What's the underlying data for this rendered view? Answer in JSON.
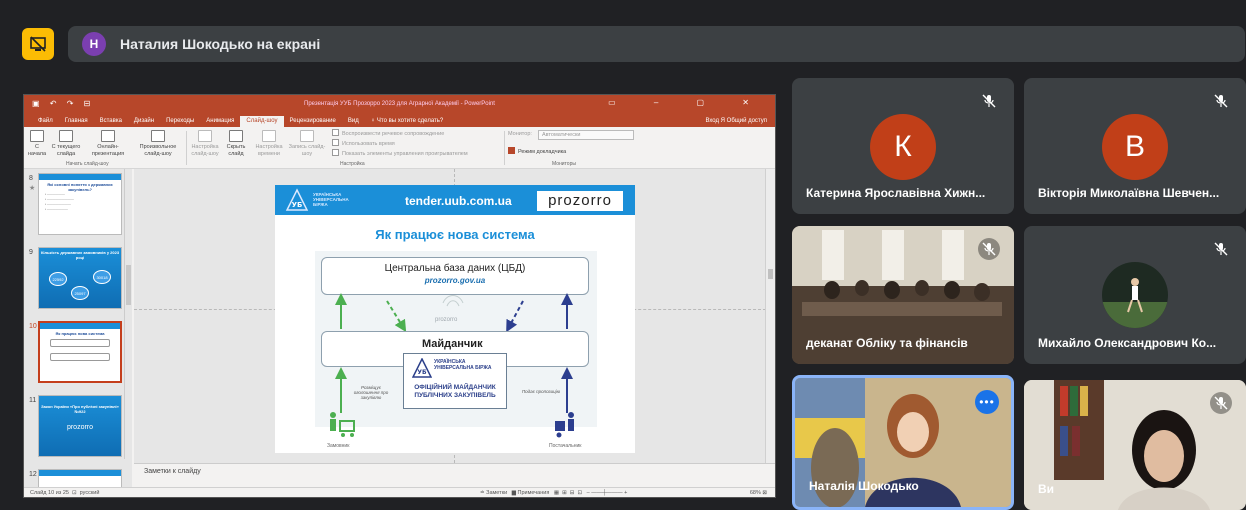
{
  "presenting": {
    "avatar_letter": "Н",
    "banner_text": "Наталия Шокодько на екрані"
  },
  "ppt": {
    "window_title": "Презентація УУБ Прозорро 2023 для Аграрної Академії - PowerPoint",
    "tabs": [
      "Файл",
      "Главная",
      "Вставка",
      "Дизайн",
      "Переходы",
      "Анимация",
      "Слайд-шоу",
      "Рецензирование",
      "Вид",
      "♀ Что вы хотите сделать?"
    ],
    "active_tab": "Слайд-шоу",
    "account": "Вход   Я Общий доступ",
    "ribbon": {
      "btn_from_start": "С начала",
      "btn_from_current": "С текущего слайда",
      "btn_online": "Онлайн-презентация",
      "btn_custom": "Произвольное слайд-шоу",
      "group_start": "Начать слайд-шоу",
      "btn_setup": "Настройка слайд-шоу",
      "btn_hide": "Скрыть слайд",
      "btn_timing": "Настройка времени",
      "btn_record": "Запись слайд-шоу",
      "chk_narration": "Воспроизвести речевое сопровождение",
      "chk_timings": "Использовать время",
      "chk_controls": "Показать элементы управления проигрывателем",
      "group_setup": "Настройка",
      "monitor_label": "Монитор:",
      "monitor_value": "Автоматически",
      "chk_presenter": "Режим докладчика",
      "group_monitors": "Мониторы"
    },
    "thumbnails": [
      {
        "num": "8",
        "title": "Які основні поняття з державних закупівель?"
      },
      {
        "num": "9",
        "title": "Кількість державних замовників у 2023 році",
        "values": [
          "22592",
          "30018",
          "25097"
        ]
      },
      {
        "num": "10",
        "title": "Як працює нова система"
      },
      {
        "num": "11",
        "title": "Закон України «Про публічні закупівлі» №922",
        "brand": "prozorro"
      },
      {
        "num": "12"
      }
    ],
    "slide": {
      "logo_text": "УКРАЇНСЬКА УНІВЕРСАЛЬНА БІРЖА",
      "site": "tender.uub.com.ua",
      "brand": "prozorro",
      "heading": "Як працює нова система",
      "cbd_title": "Центральна база даних (ЦБД)",
      "cbd_link": "prozorro.gov.ua",
      "mini_brand": "prozorro",
      "maidanchyk": "Майданчик",
      "official_logo": "УКРАЇНСЬКА УНІВЕРСАЛЬНА БІРЖА",
      "official_full": "ОФІЦІЙНИЙ МАЙДАНЧИК ПУБЛІЧНИХ ЗАКУПІВЕЛЬ",
      "note_left": "Розміщує оголошення про закупівлю",
      "note_right": "Подає пропозицію",
      "actor_left": "Замовник",
      "actor_right": "Постачальник"
    },
    "notes_label": "Заметки к слайду",
    "status": {
      "slide_info": "Слайд 10 из 25",
      "language": "русский",
      "notes_btn": "≐ Заметки",
      "comments_btn": "▆ Примечания",
      "zoom": "68%"
    }
  },
  "participants": [
    {
      "name": "Катерина Ярославівна Хижн...",
      "initial": "К",
      "avatar_color": "#c13f18",
      "muted": true
    },
    {
      "name": "Вікторія Миколаївна Шевчен...",
      "initial": "В",
      "avatar_color": "#c13f18",
      "muted": true
    },
    {
      "name": "деканат Обліку та фінансів",
      "muted": true
    },
    {
      "name": "Михайло Олександрович Ко...",
      "muted": true
    },
    {
      "name": "Наталія Шокодько",
      "speaking": true
    },
    {
      "name": "Ви",
      "muted": true
    }
  ],
  "colors": {
    "background": "#202124",
    "tile": "#3c4043",
    "presenting_icon": "#fbbc04",
    "ppt_red": "#b7472a",
    "meet_blue": "#1a73e8",
    "slide_blue": "#1b8fd8"
  }
}
